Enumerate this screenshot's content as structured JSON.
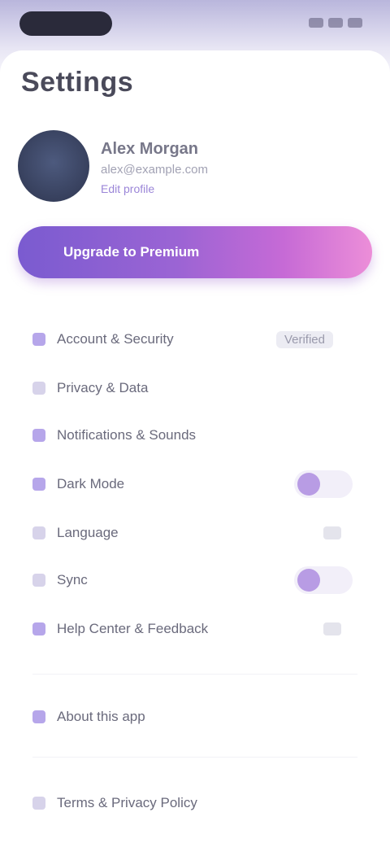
{
  "status": {
    "icons": [
      "signal-icon",
      "wifi-icon",
      "battery-icon"
    ]
  },
  "page": {
    "title": "Settings"
  },
  "profile": {
    "name": "Alex Morgan",
    "email": "alex@example.com",
    "link": "Edit profile"
  },
  "premium": {
    "label": "Upgrade to Premium"
  },
  "settings": {
    "items": [
      {
        "label": "Account & Security",
        "value": "Verified",
        "control": "value",
        "icon": "shield-icon"
      },
      {
        "label": "Privacy & Data",
        "control": "none",
        "icon": "lock-icon"
      },
      {
        "label": "Notifications & Sounds",
        "control": "none",
        "icon": "bell-icon"
      },
      {
        "label": "Dark Mode",
        "control": "toggle",
        "on": true,
        "icon": "moon-icon"
      },
      {
        "label": "Language",
        "control": "chevron",
        "icon": "globe-icon"
      },
      {
        "label": "Sync",
        "control": "toggle",
        "on": true,
        "icon": "sync-icon"
      },
      {
        "label": "Help Center & Feedback",
        "control": "chevron",
        "icon": "help-icon"
      }
    ],
    "extra": [
      {
        "label": "About this app",
        "icon": "info-icon"
      },
      {
        "label": "Terms & Privacy Policy",
        "icon": "document-icon"
      }
    ]
  },
  "colors": {
    "accent": "#7a5bd0",
    "accent_end": "#ec8ed8",
    "toggle_knob": "#b89ce4"
  }
}
